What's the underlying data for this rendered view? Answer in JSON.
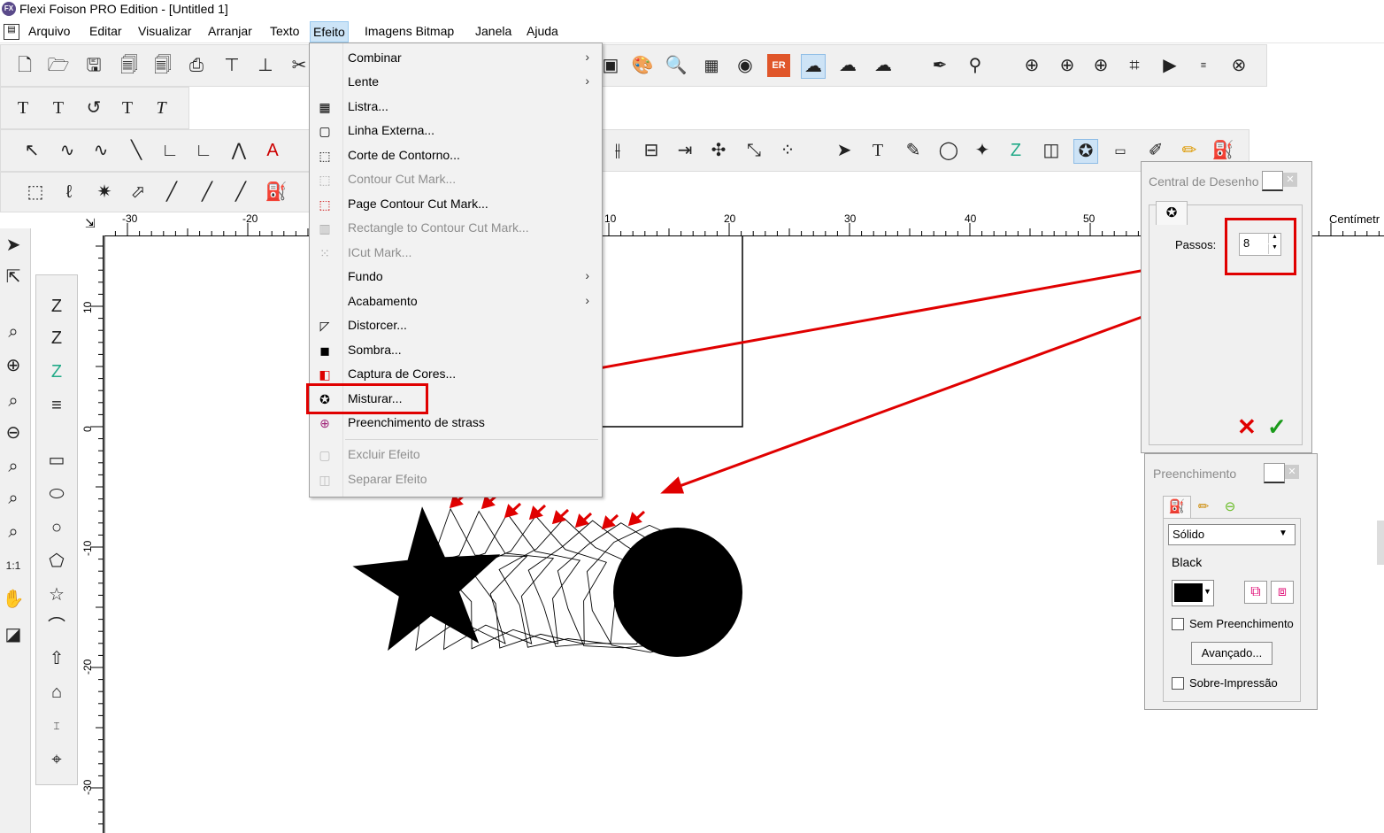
{
  "titlebar": {
    "app_icon": "FX",
    "title": "Flexi Foison PRO Edition - [Untitled 1]"
  },
  "menubar": {
    "items": [
      "Arquivo",
      "Editar",
      "Visualizar",
      "Arranjar",
      "Texto",
      "Efeito",
      "Imagens Bitmap",
      "Janela",
      "Ajuda"
    ],
    "open": "Efeito"
  },
  "efeito_menu": {
    "items": [
      {
        "label": "Combinar",
        "submenu": true,
        "enabled": true,
        "icon": ""
      },
      {
        "label": "Lente",
        "submenu": true,
        "enabled": true,
        "icon": ""
      },
      {
        "label": "Listra...",
        "submenu": false,
        "enabled": true,
        "icon": "stripes-icon"
      },
      {
        "label": "Linha Externa...",
        "submenu": false,
        "enabled": true,
        "icon": "outline-icon"
      },
      {
        "label": "Corte de Contorno...",
        "submenu": false,
        "enabled": true,
        "icon": "contour-cut-icon"
      },
      {
        "label": "Contour Cut Mark...",
        "submenu": false,
        "enabled": false,
        "icon": "contour-mark-icon"
      },
      {
        "label": "Page Contour Cut Mark...",
        "submenu": false,
        "enabled": true,
        "icon": "page-contour-mark-icon"
      },
      {
        "label": "Rectangle to Contour Cut Mark...",
        "submenu": false,
        "enabled": false,
        "icon": "rect-contour-mark-icon"
      },
      {
        "label": "ICut Mark...",
        "submenu": false,
        "enabled": false,
        "icon": "icut-mark-icon"
      },
      {
        "label": "Fundo",
        "submenu": true,
        "enabled": true,
        "icon": ""
      },
      {
        "label": "Acabamento",
        "submenu": true,
        "enabled": true,
        "icon": ""
      },
      {
        "label": "Distorcer...",
        "submenu": false,
        "enabled": true,
        "icon": "distort-icon"
      },
      {
        "label": "Sombra...",
        "submenu": false,
        "enabled": true,
        "icon": "shadow-icon"
      },
      {
        "label": "Captura de Cores...",
        "submenu": false,
        "enabled": true,
        "icon": "color-capture-icon"
      },
      {
        "label": "Misturar...",
        "submenu": false,
        "enabled": true,
        "icon": "blend-icon",
        "highlighted": true
      },
      {
        "label": "Preenchimento de strass",
        "submenu": false,
        "enabled": true,
        "icon": "rhinestone-icon"
      },
      {
        "label": "Excluir Efeito",
        "submenu": false,
        "enabled": false,
        "icon": "delete-effect-icon"
      },
      {
        "label": "Separar Efeito",
        "submenu": false,
        "enabled": false,
        "icon": "separate-effect-icon"
      }
    ]
  },
  "rulers": {
    "horizontal_labels": [
      "-30",
      "-20",
      "10",
      "20",
      "30",
      "40",
      "50"
    ],
    "unit": "Centímetro",
    "unit_visible": "Centímetr",
    "vertical_labels": [
      "10",
      "0",
      "-10",
      "-20",
      "-30"
    ]
  },
  "design_central_panel": {
    "title": "Central de Desenho",
    "title_visible": "Central de Desenho",
    "steps_label": "Passos:",
    "steps_value": "8",
    "cancel_icon": "red-x-icon",
    "ok_icon": "green-check-icon"
  },
  "fill_panel": {
    "title": "Preenchimento",
    "fill_type": "Sólido",
    "color_name": "Black",
    "color": "#000000",
    "no_fill_label": "Sem Preenchimento",
    "no_fill_checked": false,
    "advanced_button": "Avançado...",
    "overprint_label": "Sobre-Impressão",
    "overprint_checked": false
  },
  "colors": {
    "annotation": "#e00000",
    "menu_highlight": "#cce4f7"
  }
}
